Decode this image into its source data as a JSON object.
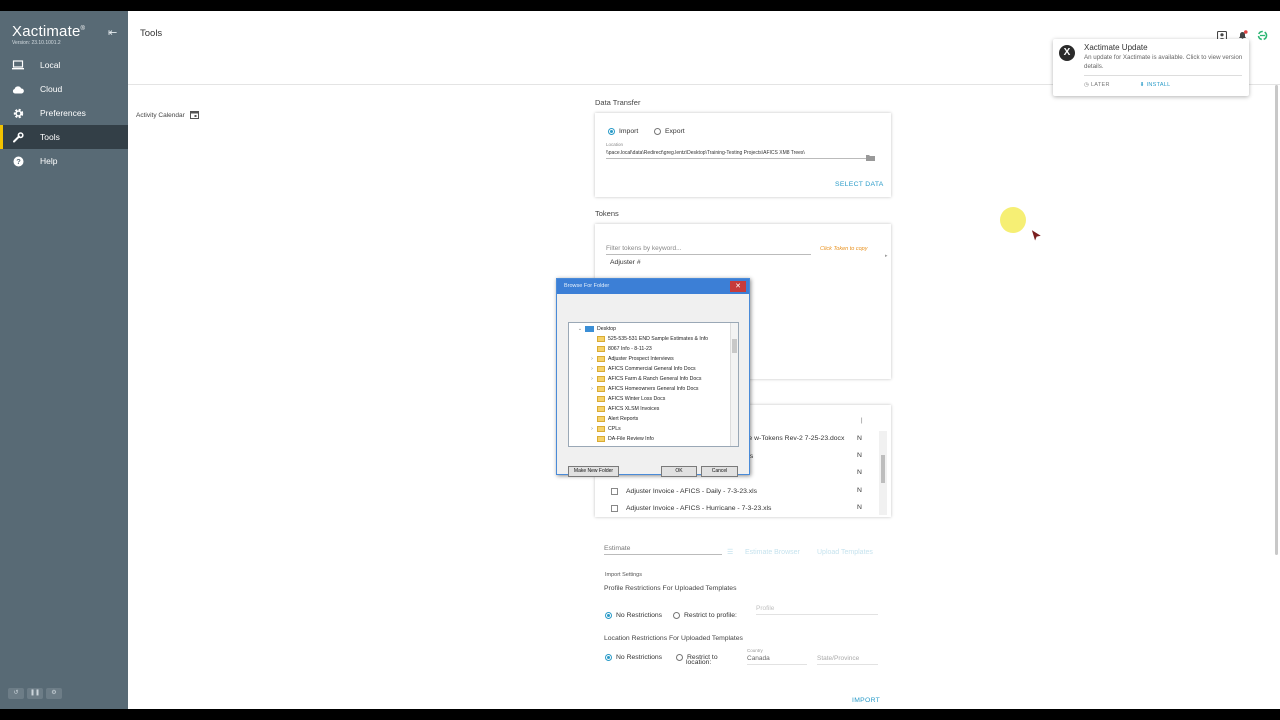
{
  "app": {
    "name": "Xactimate",
    "registered": "®",
    "version": "Version: 23.10.1001.2"
  },
  "sidebar": {
    "items": [
      {
        "label": "Local",
        "icon": "laptop-icon"
      },
      {
        "label": "Cloud",
        "icon": "cloud-icon"
      },
      {
        "label": "Preferences",
        "icon": "gear-icon"
      },
      {
        "label": "Tools",
        "icon": "wrench-icon",
        "active": true
      },
      {
        "label": "Help",
        "icon": "help-icon"
      }
    ]
  },
  "header": {
    "title": "Tools"
  },
  "toast": {
    "title": "Xactimate Update",
    "body": "An update for Xactimate is available. Click to view version details.",
    "later": "LATER",
    "install": "INSTALL"
  },
  "activity": {
    "label": "Activity Calendar"
  },
  "data_transfer": {
    "label": "Data Transfer",
    "import": "Import",
    "export": "Export",
    "location_label": "Location",
    "location_value": "\\\\pace.local\\data\\Redirect\\greg.lentz\\Desktop\\Training-Testing Projects\\AFICS XM8 Trees\\",
    "select_data": "SELECT DATA"
  },
  "tokens": {
    "label": "Tokens",
    "filter_placeholder": "Filter tokens by keyword...",
    "hint": "Click Token to copy",
    "first": "Adjuster #"
  },
  "files": {
    "rows": [
      {
        "name": "ve w-Tokens Rev-2  7-25-23.docx",
        "flag": "N"
      },
      {
        "name": "xls",
        "flag": "N"
      },
      {
        "name": "Adjuster Invoice - AFICS - Daily - 7-3-23.xls",
        "flag": "N"
      },
      {
        "name": "Adjuster Invoice - AFICS - Daily - 7-3-23.xls",
        "flag": "N"
      },
      {
        "name": "Adjuster Invoice - AFICS - Hurricane - 7-3-23.xls",
        "flag": "N"
      }
    ]
  },
  "estimate": {
    "placeholder": "Estimate",
    "btn1": "Estimate Browser",
    "btn2": "Upload Templates"
  },
  "import_settings": {
    "label": "Import Settings",
    "profile_title": "Profile Restrictions For Uploaded Templates",
    "no_restrictions": "No Restrictions",
    "restrict_profile": "Restrict to profile:",
    "profile_placeholder": "Profile",
    "location_title": "Location Restrictions For Uploaded Templates",
    "restrict_location_1": "Restrict to",
    "restrict_location_2": "location:",
    "country_label": "Country",
    "country_value": "Canada",
    "state_placeholder": "State/Province",
    "import_btn": "IMPORT"
  },
  "dialog": {
    "title": "Browse For Folder",
    "tree": [
      {
        "label": "Desktop",
        "root": true
      },
      {
        "label": "525-535-531 END Sample Estimates & Info"
      },
      {
        "label": "8067 Info - 8-11-23"
      },
      {
        "label": "Adjuster Prospect Interviews",
        "expand": true
      },
      {
        "label": "AFICS Commercial General Info Docs",
        "expand": true
      },
      {
        "label": "AFICS Farm & Ranch General Info Docs",
        "expand": true
      },
      {
        "label": "AFICS Homeowners General Info Docs",
        "expand": true
      },
      {
        "label": "AFICS Winter Loss Docs"
      },
      {
        "label": "AFICS XLSM Invoices"
      },
      {
        "label": "Alert Reports"
      },
      {
        "label": "CPLs",
        "expand": true
      },
      {
        "label": "DA-File Review Info"
      }
    ],
    "make_new_folder": "Make New Folder",
    "ok": "OK",
    "cancel": "Cancel"
  }
}
